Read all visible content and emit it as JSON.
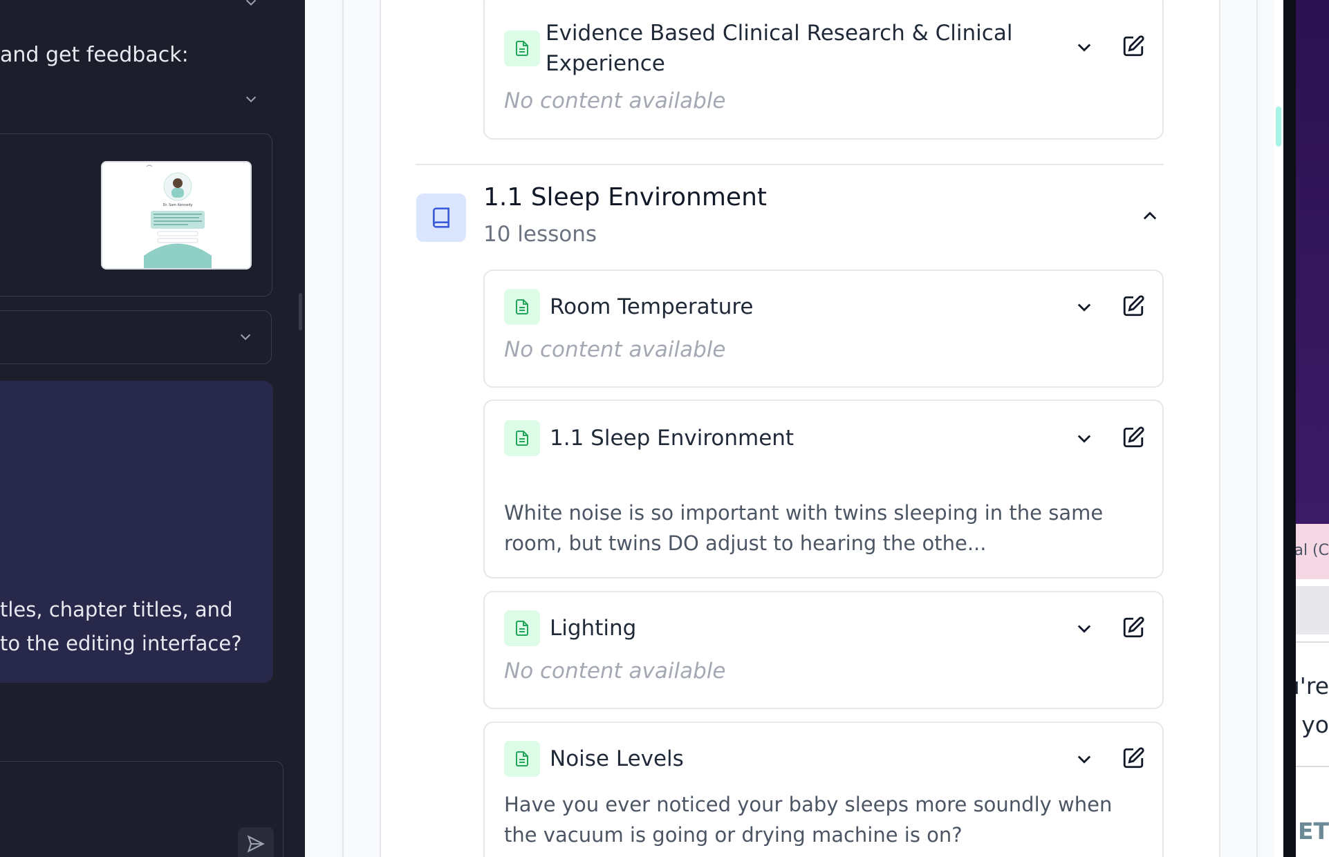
{
  "chat": {
    "feedback_prompt": "and get feedback:",
    "message_line_1": "tles, chapter titles, and",
    "message_line_2": "to the editing interface?"
  },
  "preview_thumbnail": {
    "name_text": "Dr. Sam Kennedy"
  },
  "chapter": {
    "title": "1.1 Sleep Environment",
    "lesson_count": "10 lessons"
  },
  "lessons": [
    {
      "title_line_1": "Evidence Based Clinical Research & Clinical",
      "title_line_2": "Experience",
      "body": "No content available"
    },
    {
      "title": "Room Temperature",
      "body": "No content available"
    },
    {
      "title": "1.1 Sleep Environment",
      "body_line_1": "White noise is so important with twins sleeping in the same",
      "body_line_2": "room, but twins DO adjust to hearing the othe..."
    },
    {
      "title": "Lighting",
      "body": "No content available"
    },
    {
      "title": "Noise Levels",
      "body_line_1": "Have you ever noticed your baby sleeps more soundly when",
      "body_line_2": "the vacuum is going or drying machine is on?"
    }
  ],
  "right_panel": {
    "pink_tab_text": "ral (C",
    "text_1": "u're",
    "text_2": "yo",
    "text_3": "ET"
  },
  "colors": {
    "panel_dark": "#1d1e2b",
    "message_bubble": "#28284a",
    "doc_icon_bg": "#dcfce7",
    "doc_icon_fg": "#22a65a",
    "chapter_icon_bg": "#dbe6fe",
    "chapter_icon_fg": "#3b5bdb"
  },
  "icons": [
    "chevron-down-icon",
    "chevron-up-icon",
    "edit-icon",
    "document-icon",
    "book-icon",
    "send-icon"
  ]
}
